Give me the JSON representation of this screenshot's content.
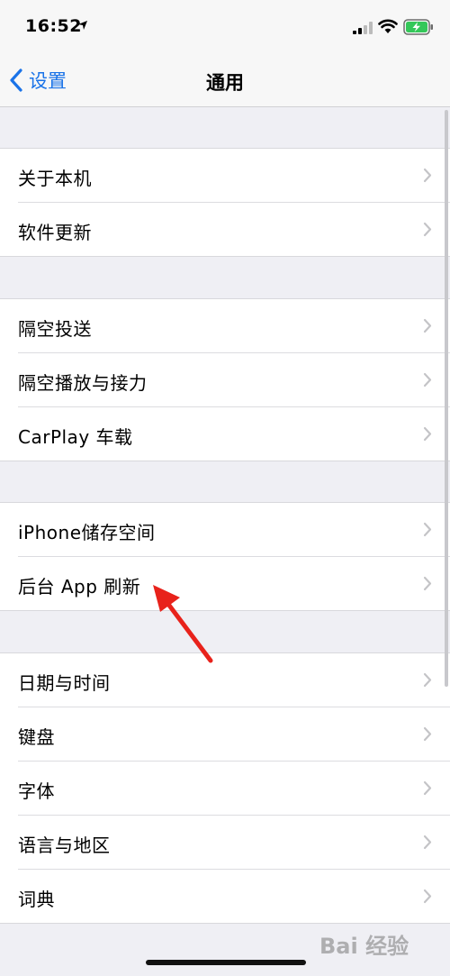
{
  "status": {
    "time": "16:52"
  },
  "nav": {
    "back_label": "设置",
    "title": "通用"
  },
  "groups": [
    {
      "items": [
        {
          "label": "关于本机"
        },
        {
          "label": "软件更新"
        }
      ]
    },
    {
      "items": [
        {
          "label": "隔空投送"
        },
        {
          "label": "隔空播放与接力"
        },
        {
          "label": "CarPlay 车载"
        }
      ]
    },
    {
      "items": [
        {
          "label": "iPhone储存空间"
        },
        {
          "label": "后台 App 刷新"
        }
      ]
    },
    {
      "items": [
        {
          "label": "日期与时间"
        },
        {
          "label": "键盘"
        },
        {
          "label": "字体"
        },
        {
          "label": "语言与地区"
        },
        {
          "label": "词典"
        }
      ]
    }
  ],
  "watermark": "Bai 经验",
  "colors": {
    "accent": "#1a73e8",
    "annotation": "#e8221b"
  }
}
